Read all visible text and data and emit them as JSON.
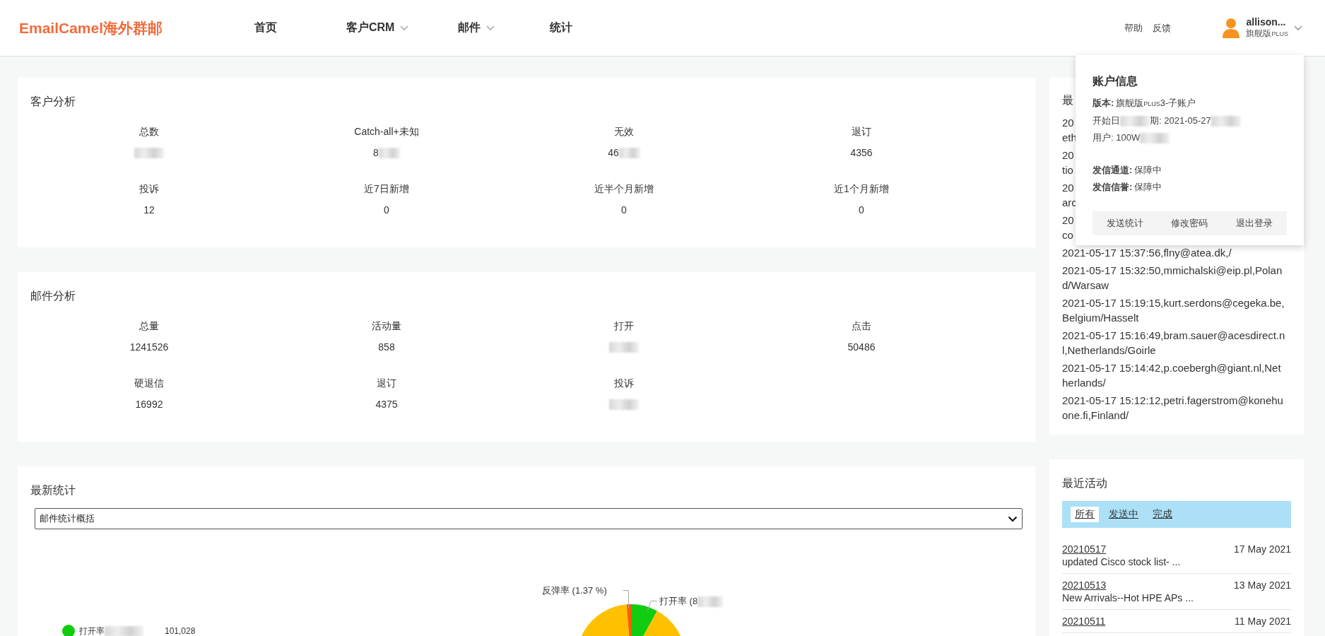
{
  "header": {
    "logo": "EmailCamel海外群邮",
    "nav": [
      {
        "label": "首页",
        "dropdown": false
      },
      {
        "label": "客户CRM",
        "dropdown": true
      },
      {
        "label": "邮件",
        "dropdown": true
      },
      {
        "label": "统计",
        "dropdown": false
      }
    ],
    "links": [
      "帮助",
      "反馈"
    ],
    "user": {
      "name": "allison...",
      "plan": "旗舰版",
      "plan_suffix": "PLUS"
    }
  },
  "customer_analysis": {
    "title": "客户分析",
    "stats": [
      {
        "label": "总数",
        "blurred": true
      },
      {
        "label": "Catch-all+未知",
        "value": "8",
        "blurred": true
      },
      {
        "label": "无效",
        "value": "46",
        "blurred": true
      },
      {
        "label": "退订",
        "value": "4356",
        "blurred": false
      },
      {
        "label": "投诉",
        "value": "12",
        "blurred": false
      },
      {
        "label": "近7日新增",
        "value": "0",
        "blurred": false
      },
      {
        "label": "近半个月新增",
        "value": "0",
        "blurred": false
      },
      {
        "label": "近1个月新增",
        "value": "0",
        "blurred": false
      }
    ]
  },
  "mail_analysis": {
    "title": "邮件分析",
    "stats": [
      {
        "label": "总量",
        "value": "1241526",
        "blurred": false
      },
      {
        "label": "活动量",
        "value": "858",
        "blurred": false
      },
      {
        "label": "打开",
        "blurred": true
      },
      {
        "label": "点击",
        "value": "50486",
        "blurred": false
      },
      {
        "label": "硬退信",
        "value": "16992",
        "blurred": false
      },
      {
        "label": "退订",
        "value": "4375",
        "blurred": false
      },
      {
        "label": "投诉",
        "blurred": true
      }
    ]
  },
  "latest_stats": {
    "title": "最新统计",
    "select": {
      "value": "邮件统计概括"
    },
    "chart": {
      "labels": [
        {
          "text": "反弹率 (1.37 %)",
          "blurred": false
        },
        {
          "text": "打开率 (8",
          "blurred": true
        }
      ],
      "legend": [
        {
          "label": "打开率",
          "color": "#11cc11",
          "blurred": true,
          "value": "101,028"
        }
      ]
    }
  },
  "latest_opens": {
    "title": "最",
    "entries": [
      {
        "lines": [
          "20",
          "eth"
        ]
      },
      {
        "lines": [
          "20",
          "tio"
        ]
      },
      {
        "lines": [
          "20",
          "arc"
        ]
      },
      {
        "lines": [
          "20",
          "co"
        ]
      },
      {
        "lines": [
          "2021-05-17 15:37:56,flny@atea.dk,/"
        ]
      },
      {
        "lines": [
          "2021-05-17 15:32:50,mmichalski@eip.pl,Polan",
          "d/Warsaw"
        ]
      },
      {
        "lines": [
          "2021-05-17 15:19:15,kurt.serdons@cegeka.be,",
          "Belgium/Hasselt"
        ]
      },
      {
        "lines": [
          "2021-05-17 15:16:49,bram.sauer@acesdirect.n",
          "l,Netherlands/Goirle"
        ]
      },
      {
        "lines": [
          "2021-05-17 15:14:42,p.coebergh@giant.nl,Net",
          "herlands/"
        ]
      },
      {
        "lines": [
          "2021-05-17 15:12:12,petri.fagerstrom@konehu",
          "one.fi,Finland/"
        ]
      }
    ]
  },
  "recent_activity": {
    "title": "最近活动",
    "tabs": [
      {
        "label": "所有",
        "selected": true
      },
      {
        "label": "发送中",
        "selected": false
      },
      {
        "label": "完成",
        "selected": false
      }
    ],
    "items": [
      {
        "id": "20210517",
        "date": "17 May 2021",
        "desc": "updated Cisco stock list- ..."
      },
      {
        "id": "20210513",
        "date": "13 May 2021",
        "desc": "New Arrivals--Hot HPE APs ..."
      },
      {
        "id": "20210511",
        "date": "11 May 2021"
      }
    ]
  },
  "account_popup": {
    "title": "账户信息",
    "sections": [
      [
        {
          "label": "版本:",
          "segments": [
            {
              "kind": "text",
              "text": "旗舰版"
            },
            {
              "kind": "small",
              "text": "PLUS"
            },
            {
              "kind": "text",
              "text": "3-子账户"
            }
          ]
        },
        {
          "segments": [
            {
              "kind": "text",
              "text": "开始日"
            },
            {
              "kind": "blur"
            },
            {
              "kind": "text",
              "text": "期: 2021-05-27"
            },
            {
              "kind": "blur"
            }
          ]
        },
        {
          "segments": [
            {
              "kind": "text",
              "text": "用户: 100W"
            },
            {
              "kind": "blur"
            }
          ]
        }
      ],
      [
        {
          "label": "发信通道:",
          "segments": [
            {
              "kind": "text",
              "text": "保障中"
            }
          ]
        },
        {
          "label": "发信信誉:",
          "segments": [
            {
              "kind": "text",
              "text": "保障中"
            }
          ]
        }
      ]
    ],
    "actions": [
      "发送统计",
      "修改密码",
      "退出登录"
    ]
  }
}
